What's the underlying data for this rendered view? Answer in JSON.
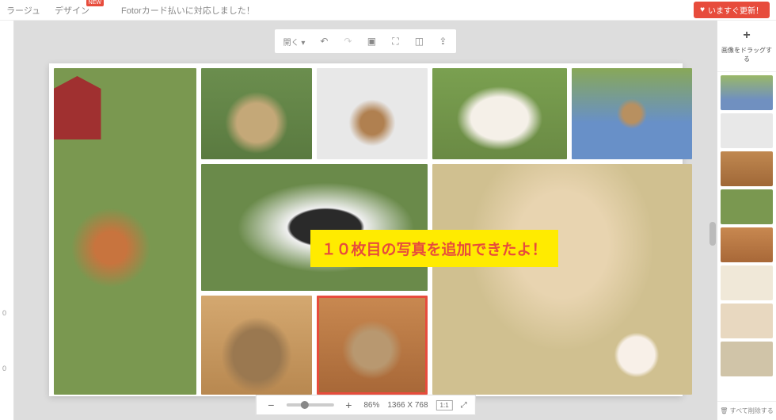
{
  "nav": {
    "collage": "ラージュ",
    "design": "デザイン",
    "new_badge": "NEW",
    "notice": "Fotorカード払いに対応しました！"
  },
  "update_button": "いますぐ更新！",
  "toolbar": {
    "open": "開く ▾"
  },
  "zoom": {
    "percent": "86%",
    "dimensions": "1366 X 768",
    "ratio": "1:1"
  },
  "left_rail": {
    "v1": "0",
    "v2": "0"
  },
  "annotation": "１０枚目の写真を追加できたよ！",
  "right": {
    "drag_hint": "画像をドラッグする",
    "delete_all": "すべて削除する"
  }
}
